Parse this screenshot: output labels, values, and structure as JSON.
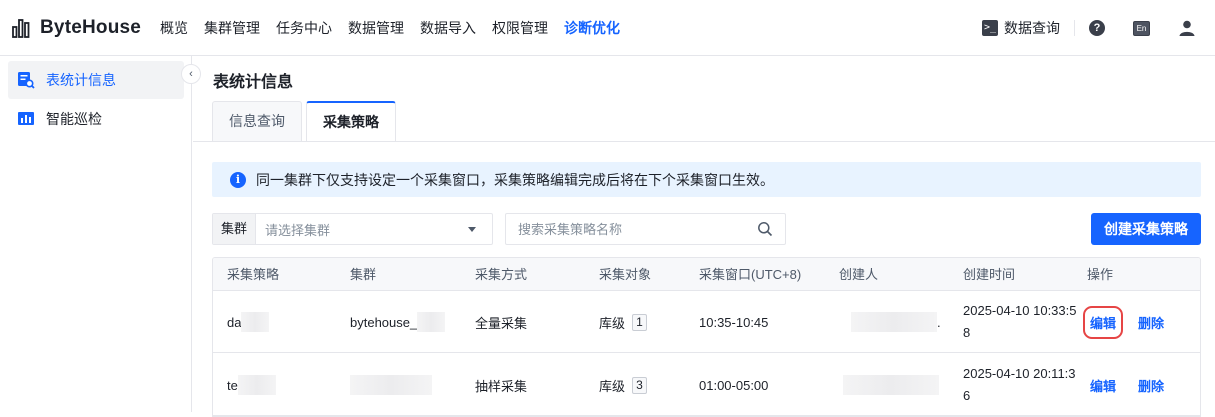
{
  "app": {
    "logo_text": "ByteHouse"
  },
  "nav": {
    "items": [
      {
        "label": "概览"
      },
      {
        "label": "集群管理"
      },
      {
        "label": "任务中心"
      },
      {
        "label": "数据管理"
      },
      {
        "label": "数据导入"
      },
      {
        "label": "权限管理"
      },
      {
        "label": "诊断优化",
        "active": true
      }
    ],
    "query_label": "数据查询",
    "lang_label": "En"
  },
  "sidebar": {
    "items": [
      {
        "label": "表统计信息",
        "icon": "table-stats-icon",
        "active": true
      },
      {
        "label": "智能巡检",
        "icon": "bar-chart-icon"
      }
    ]
  },
  "page": {
    "title": "表统计信息",
    "tabs": [
      {
        "label": "信息查询"
      },
      {
        "label": "采集策略",
        "active": true
      }
    ],
    "notice": "同一集群下仅支持设定一个采集窗口，采集策略编辑完成后将在下个采集窗口生效。"
  },
  "filters": {
    "cluster_prefix": "集群",
    "cluster_placeholder": "请选择集群",
    "search_placeholder": "搜索采集策略名称",
    "create_button": "创建采集策略"
  },
  "table": {
    "headers": [
      "采集策略",
      "集群",
      "采集方式",
      "采集对象",
      "采集窗口(UTC+8)",
      "创建人",
      "创建时间",
      "操作"
    ],
    "rows": [
      {
        "policy": "da",
        "cluster": "bytehouse_",
        "method": "全量采集",
        "object_label": "库级",
        "object_count": "1",
        "window": "10:35-10:45",
        "creator": ".",
        "created_at": "2025-04-10 10:33:58",
        "edit": "编辑",
        "delete": "删除"
      },
      {
        "policy": "te",
        "cluster": "",
        "method": "抽样采集",
        "object_label": "库级",
        "object_count": "3",
        "window": "01:00-05:00",
        "creator": "",
        "created_at": "2025-04-10 20:11:36",
        "edit": "编辑",
        "delete": "删除"
      }
    ]
  },
  "colors": {
    "accent": "#1664ff",
    "highlight_box": "#e64545",
    "notice_bg": "#e8f3ff"
  }
}
